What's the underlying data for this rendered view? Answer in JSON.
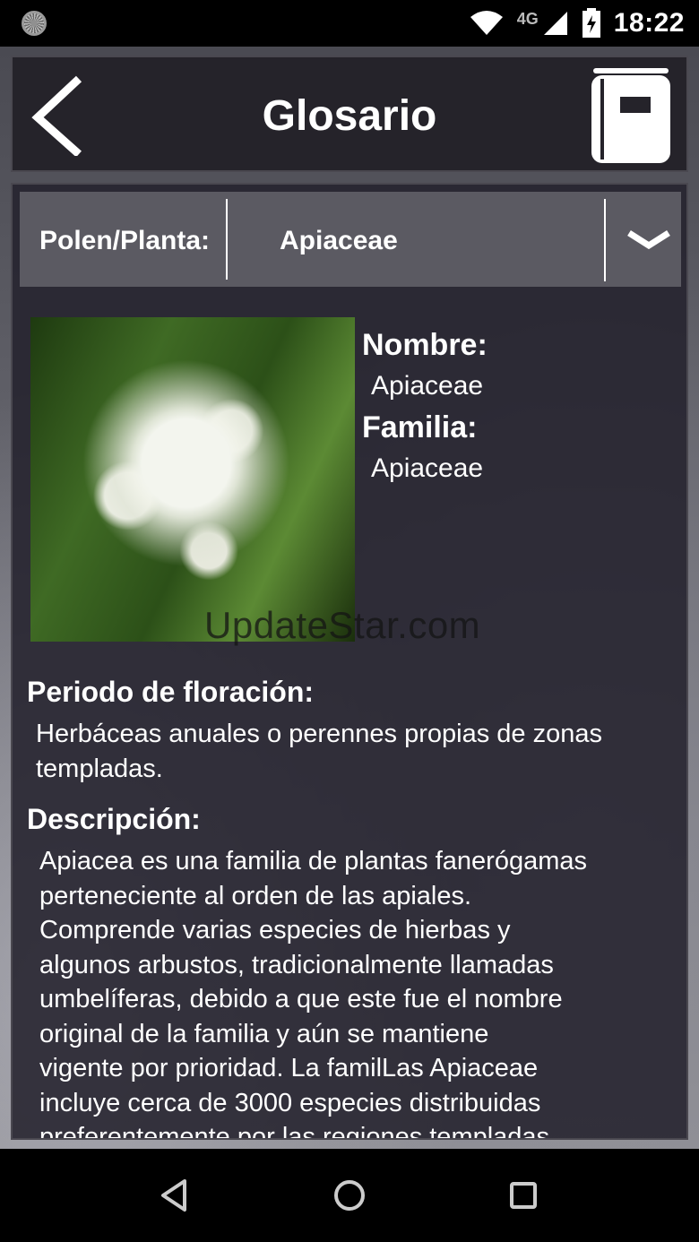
{
  "status_bar": {
    "network": "4G",
    "time": "18:22"
  },
  "header": {
    "title": "Glosario",
    "back_icon": "chevron-left-icon",
    "book_icon": "book-icon"
  },
  "selector": {
    "label": "Polen/Planta:",
    "value": "Apiaceae",
    "dropdown_icon": "chevron-down-icon"
  },
  "plant": {
    "name_label": "Nombre:",
    "name_value": "Apiaceae",
    "family_label": "Familia:",
    "family_value": "Apiaceae",
    "watermark": "UpdateStar.com"
  },
  "flowering": {
    "title": "Periodo de floración:",
    "lines": [
      "Herbáceas anuales o perennes propias de zonas",
      "templadas."
    ]
  },
  "description": {
    "title": "Descripción:",
    "lines": [
      "Apiacea es una familia de plantas fanerógamas",
      "perteneciente al orden de las apiales.",
      "Comprende varias especies de hierbas y",
      "algunos arbustos, tradicionalmente llamadas",
      "umbelíferas, debido a que este fue el nombre",
      "original de la familia y aún se mantiene",
      "vigente por prioridad. La famil­Las Apiaceae",
      "incluye cerca de 3000 especies distribuidas",
      "preferentemente por las regiones templadas"
    ]
  },
  "nav": {
    "back_icon": "triangle-back-icon",
    "home_icon": "circle-home-icon",
    "recents_icon": "square-recents-icon"
  }
}
